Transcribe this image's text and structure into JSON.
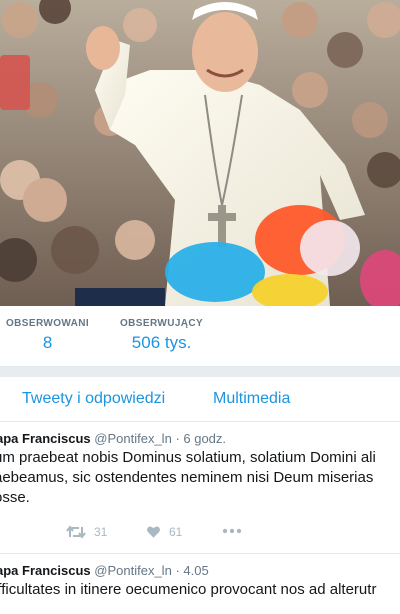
{
  "profile": {
    "stats": [
      {
        "label": "OBSERWOWANI",
        "value": "8"
      },
      {
        "label": "OBSERWUJĄCY",
        "value": "506 tys."
      }
    ]
  },
  "tabs": [
    {
      "label": "Tweety i odpowiedzi"
    },
    {
      "label": "Multimedia"
    }
  ],
  "tweets": [
    {
      "name": "apa Franciscus",
      "handle": "@Pontifex_ln",
      "time": "· 6 godz.",
      "lines": [
        "um praebeat nobis Dominus solatium, solatium Domini ali",
        "aebeamus, sic ostendentes neminem nisi Deum miserias",
        "osse."
      ],
      "retweets": "31",
      "likes": "61"
    },
    {
      "name": "apa Franciscus",
      "handle": "@Pontifex_ln",
      "time": "· 4.05",
      "lines": [
        "ifficultates in itinere oecumenico provocant nos ad alterutr"
      ]
    }
  ],
  "icons": {
    "retweet": "retweet-icon",
    "like": "heart-icon",
    "more": "more-icon"
  },
  "colors": {
    "accent": "#1b95e0",
    "muted": "#657786",
    "icon": "#aab8c2",
    "separator": "#e6ecf0"
  }
}
